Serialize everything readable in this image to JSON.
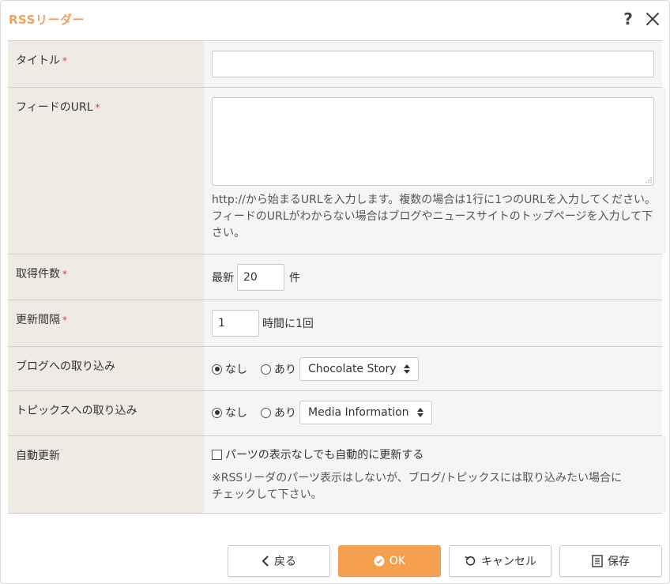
{
  "dialog": {
    "title": "RSSリーダー",
    "help_icon": "help-icon",
    "close_icon": "close-icon"
  },
  "fields": {
    "title": {
      "label": "タイトル",
      "required": "*",
      "value": ""
    },
    "feed_url": {
      "label": "フィードのURL",
      "required": "*",
      "value": "",
      "help_line1": "http://から始まるURLを入力します。複数の場合は1行に1つのURLを入力してください。",
      "help_line2": "フィードのURLがわからない場合はブログやニュースサイトのトップページを入力して下さい。"
    },
    "count": {
      "label": "取得件数",
      "required": "*",
      "prefix": "最新",
      "value": "20",
      "suffix": "件"
    },
    "interval": {
      "label": "更新間隔",
      "required": "*",
      "value": "1",
      "suffix": "時間に1回"
    },
    "blog_import": {
      "label": "ブログへの取り込み",
      "option_none": "なし",
      "option_yes": "あり",
      "selected": "none",
      "select_value": "Chocolate Story"
    },
    "topics_import": {
      "label": "トピックスへの取り込み",
      "option_none": "なし",
      "option_yes": "あり",
      "selected": "none",
      "select_value": "Media Information"
    },
    "auto_update": {
      "label": "自動更新",
      "checkbox_label": "パーツの表示なしでも自動的に更新する",
      "checked": false,
      "note_line1": "※RSSリーダのパーツ表示はしないが、ブログ/トピックスには取り込みたい場合に",
      "note_line2": "チェックして下さい。"
    }
  },
  "buttons": {
    "back": "戻る",
    "ok": "OK",
    "cancel": "キャンセル",
    "save": "保存"
  },
  "colors": {
    "accent": "#f5a04f",
    "title": "#f0a05c",
    "label_bg": "#efeae4",
    "value_bg": "#f5f5f5",
    "required": "#e23b3b"
  }
}
